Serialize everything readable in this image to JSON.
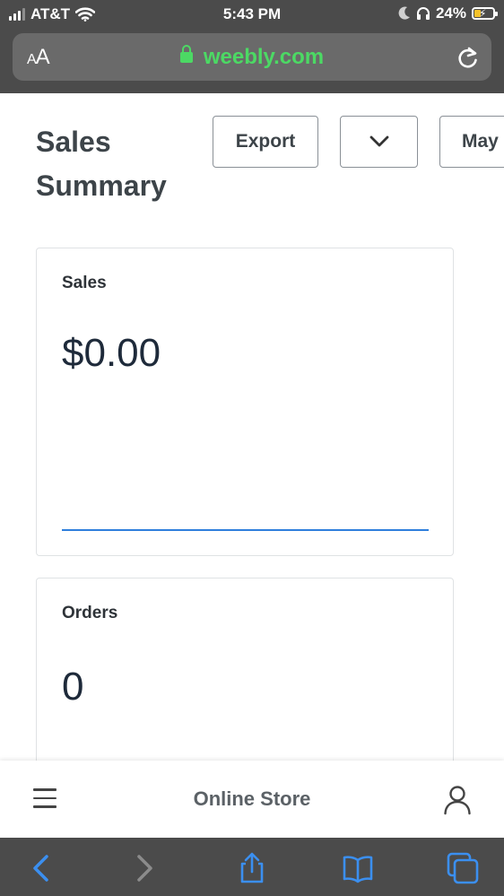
{
  "status_bar": {
    "carrier": "AT&T",
    "time": "5:43 PM",
    "battery_percent": "24%",
    "signal_bars": 4,
    "signal_bars_active": 3,
    "icons": [
      "signal-icon",
      "wifi-icon",
      "moon-icon",
      "headphones-icon",
      "battery-charging-icon"
    ]
  },
  "browser": {
    "text_size_label_small": "A",
    "text_size_label_large": "A",
    "url": "weebly.com",
    "url_color": "#4cd964"
  },
  "page": {
    "title": "Sales Summary",
    "export_label": "Export",
    "period_label": "May"
  },
  "cards": {
    "sales": {
      "label": "Sales",
      "value": "$0.00"
    },
    "orders": {
      "label": "Orders",
      "value": "0"
    }
  },
  "app_nav": {
    "title": "Online Store"
  },
  "colors": {
    "chrome": "#4b4b4b",
    "accent_blue": "#2f7fdc",
    "safari_blue": "#3b8ff0"
  }
}
